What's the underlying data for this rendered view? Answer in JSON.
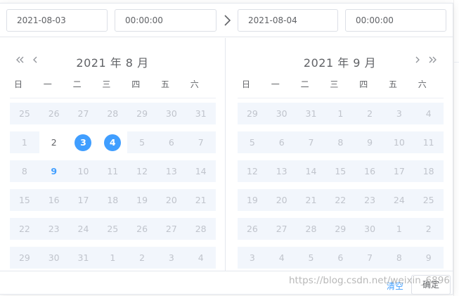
{
  "range": {
    "start_date": "2021-08-03",
    "start_time": "00:00:00",
    "end_date": "2021-08-04",
    "end_time": "00:00:00"
  },
  "weekdays": [
    "日",
    "一",
    "二",
    "三",
    "四",
    "五",
    "六"
  ],
  "left_calendar": {
    "title": "2021 年 8 月",
    "rows": [
      [
        "25",
        "26",
        "27",
        "28",
        "29",
        "30",
        "31"
      ],
      [
        "1",
        "2",
        "3",
        "4",
        "5",
        "6",
        "7"
      ],
      [
        "8",
        "9",
        "10",
        "11",
        "12",
        "13",
        "14"
      ],
      [
        "15",
        "16",
        "17",
        "18",
        "19",
        "20",
        "21"
      ],
      [
        "22",
        "23",
        "24",
        "25",
        "26",
        "27",
        "28"
      ],
      [
        "29",
        "30",
        "31",
        "1",
        "2",
        "3",
        "4"
      ]
    ],
    "states": [
      [
        "",
        "",
        "",
        "",
        "",
        "",
        ""
      ],
      [
        "",
        "available",
        "selected",
        "selected",
        "",
        "",
        ""
      ],
      [
        "",
        "today",
        "",
        "",
        "",
        "",
        ""
      ],
      [
        "",
        "",
        "",
        "",
        "",
        "",
        ""
      ],
      [
        "",
        "",
        "",
        "",
        "",
        "",
        ""
      ],
      [
        "",
        "",
        "",
        "",
        "",
        "",
        ""
      ]
    ]
  },
  "right_calendar": {
    "title": "2021 年 9 月",
    "rows": [
      [
        "29",
        "30",
        "31",
        "1",
        "2",
        "3",
        "4"
      ],
      [
        "5",
        "6",
        "7",
        "8",
        "9",
        "10",
        "11"
      ],
      [
        "12",
        "13",
        "14",
        "15",
        "16",
        "17",
        "18"
      ],
      [
        "19",
        "20",
        "21",
        "22",
        "23",
        "24",
        "25"
      ],
      [
        "26",
        "27",
        "28",
        "29",
        "30",
        "1",
        "2"
      ],
      [
        "3",
        "4",
        "5",
        "6",
        "7",
        "8",
        "9"
      ]
    ]
  },
  "footer": {
    "clear_label": "清空",
    "confirm_label": "确定"
  },
  "watermark": "https://blog.csdn.net/weixin_6896",
  "colors": {
    "accent": "#409eff",
    "border": "#e4e7ed",
    "disabled_text": "#c0c4cc",
    "row_bg": "#f2f6fc"
  }
}
